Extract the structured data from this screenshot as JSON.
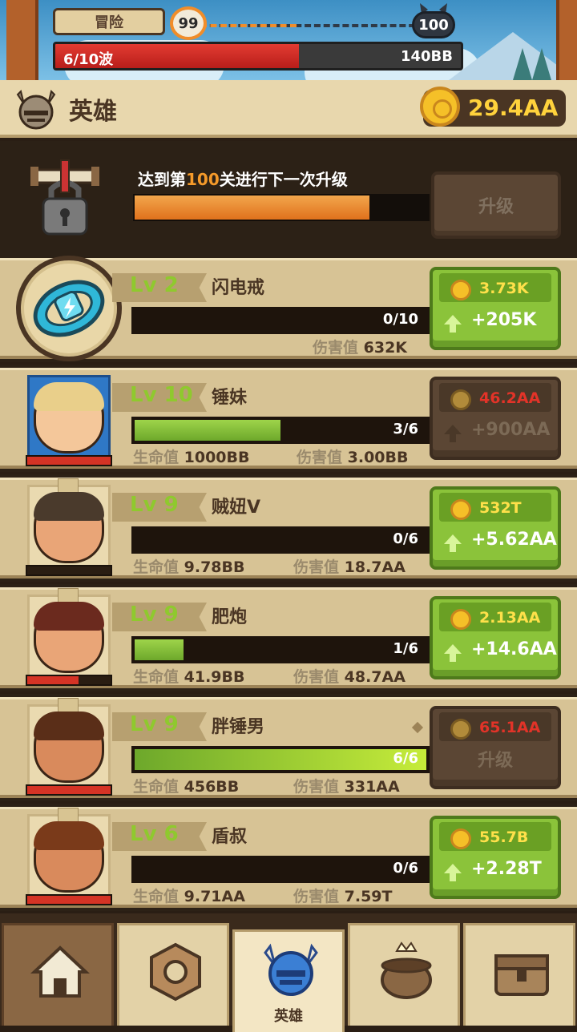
{
  "top": {
    "mode_label": "冒险",
    "current_level": "99",
    "boss_level": "100",
    "wave_label": "6/10波",
    "enemy_hp": "140BB",
    "wave_progress": 0.6
  },
  "header": {
    "title": "英雄",
    "gold": "29.4AA"
  },
  "unlock": {
    "text_prefix": "达到第",
    "text_level": "100",
    "text_suffix": "关进行下一次升级",
    "progress": 0.8,
    "button_label": "升级"
  },
  "items": [
    {
      "level_prefix": "Lv",
      "level": "2",
      "name": "闪电戒",
      "count": "0/10",
      "progress": 0.0,
      "stat1_label": "",
      "stat1_value": "",
      "stat2_label": "伤害值",
      "stat2_value": "632K",
      "cost": "3.73K",
      "gain": "+205K",
      "affordable": true,
      "hp": 0
    },
    {
      "level_prefix": "Lv",
      "level": "10",
      "name": "锤妹",
      "count": "3/6",
      "progress": 0.5,
      "stat1_label": "生命值",
      "stat1_value": "1000BB",
      "stat2_label": "伤害值",
      "stat2_value": "3.00BB",
      "cost": "46.2AA",
      "gain": "+900AA",
      "affordable": false,
      "hp": 1.0
    },
    {
      "level_prefix": "Lv",
      "level": "9",
      "name": "贼妞V",
      "count": "0/6",
      "progress": 0.0,
      "stat1_label": "生命值",
      "stat1_value": "9.78BB",
      "stat2_label": "伤害值",
      "stat2_value": "18.7AA",
      "cost": "532T",
      "gain": "+5.62AA",
      "affordable": true,
      "hp": 0
    },
    {
      "level_prefix": "Lv",
      "level": "9",
      "name": "肥炮",
      "count": "1/6",
      "progress": 0.167,
      "stat1_label": "生命值",
      "stat1_value": "41.9BB",
      "stat2_label": "伤害值",
      "stat2_value": "48.7AA",
      "cost": "2.13AA",
      "gain": "+14.6AA",
      "affordable": true,
      "hp": 0.62
    },
    {
      "level_prefix": "Lv",
      "level": "9",
      "name": "胖锤男",
      "count": "6/6",
      "progress": 1.0,
      "stat1_label": "生命值",
      "stat1_value": "456BB",
      "stat2_label": "伤害值",
      "stat2_value": "331AA",
      "cost": "65.1AA",
      "gain": "",
      "upgrade_label": "升级",
      "affordable": false,
      "hp": 1.0
    },
    {
      "level_prefix": "Lv",
      "level": "6",
      "name": "盾叔",
      "count": "0/6",
      "progress": 0.0,
      "stat1_label": "生命值",
      "stat1_value": "9.71AA",
      "stat2_label": "伤害值",
      "stat2_value": "7.59T",
      "cost": "55.7B",
      "gain": "+2.28T",
      "affordable": true,
      "hp": 1.0
    }
  ],
  "nav": {
    "tabs": [
      {
        "icon": "home-icon",
        "label": ""
      },
      {
        "icon": "nut-icon",
        "label": ""
      },
      {
        "icon": "helmet-icon",
        "label": "英雄",
        "active": true
      },
      {
        "icon": "cauldron-icon",
        "label": ""
      },
      {
        "icon": "chest-icon",
        "label": ""
      }
    ]
  },
  "colors": {
    "accent_green": "#8bc33a",
    "gold": "#ffd23c",
    "cost_red": "#e23328",
    "level_green": "#8fc92e"
  }
}
